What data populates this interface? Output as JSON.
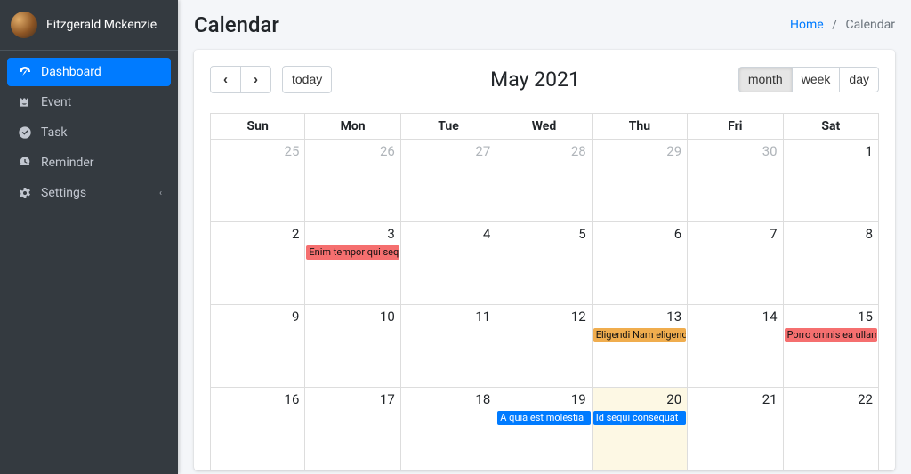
{
  "user": {
    "name": "Fitzgerald Mckenzie"
  },
  "sidebar": {
    "items": [
      {
        "label": "Dashboard",
        "icon": "dashboard-icon",
        "active": true,
        "has_sub": false
      },
      {
        "label": "Event",
        "icon": "event-icon",
        "active": false,
        "has_sub": false
      },
      {
        "label": "Task",
        "icon": "task-icon",
        "active": false,
        "has_sub": false
      },
      {
        "label": "Reminder",
        "icon": "reminder-icon",
        "active": false,
        "has_sub": false
      },
      {
        "label": "Settings",
        "icon": "settings-icon",
        "active": false,
        "has_sub": true
      }
    ]
  },
  "header": {
    "title": "Calendar",
    "breadcrumb": {
      "home": "Home",
      "current": "Calendar"
    }
  },
  "toolbar": {
    "prev": "‹",
    "next": "›",
    "today": "today",
    "title": "May 2021",
    "views": {
      "month": "month",
      "week": "week",
      "day": "day"
    },
    "active_view": "month"
  },
  "calendar": {
    "dow": [
      "Sun",
      "Mon",
      "Tue",
      "Wed",
      "Thu",
      "Fri",
      "Sat"
    ],
    "today": "2021-05-20",
    "weeks": [
      [
        {
          "n": 25,
          "other": true
        },
        {
          "n": 26,
          "other": true
        },
        {
          "n": 27,
          "other": true
        },
        {
          "n": 28,
          "other": true
        },
        {
          "n": 29,
          "other": true
        },
        {
          "n": 30,
          "other": true
        },
        {
          "n": 1
        }
      ],
      [
        {
          "n": 2
        },
        {
          "n": 3,
          "events": [
            {
              "title": "Enim tempor qui sequ",
              "color": "salmon"
            }
          ]
        },
        {
          "n": 4
        },
        {
          "n": 5
        },
        {
          "n": 6
        },
        {
          "n": 7
        },
        {
          "n": 8
        }
      ],
      [
        {
          "n": 9
        },
        {
          "n": 10
        },
        {
          "n": 11
        },
        {
          "n": 12
        },
        {
          "n": 13,
          "events": [
            {
              "title": "Eligendi Nam eligend",
              "color": "amber"
            }
          ]
        },
        {
          "n": 14
        },
        {
          "n": 15,
          "events": [
            {
              "title": "Porro omnis ea ullam",
              "color": "salmon"
            }
          ]
        }
      ],
      [
        {
          "n": 16
        },
        {
          "n": 17
        },
        {
          "n": 18
        },
        {
          "n": 19,
          "events": [
            {
              "title": "A quia est molestia",
              "color": "blue"
            }
          ]
        },
        {
          "n": 20,
          "today": true,
          "events": [
            {
              "title": "Id sequi consequat",
              "color": "blue"
            }
          ]
        },
        {
          "n": 21
        },
        {
          "n": 22
        }
      ]
    ]
  }
}
